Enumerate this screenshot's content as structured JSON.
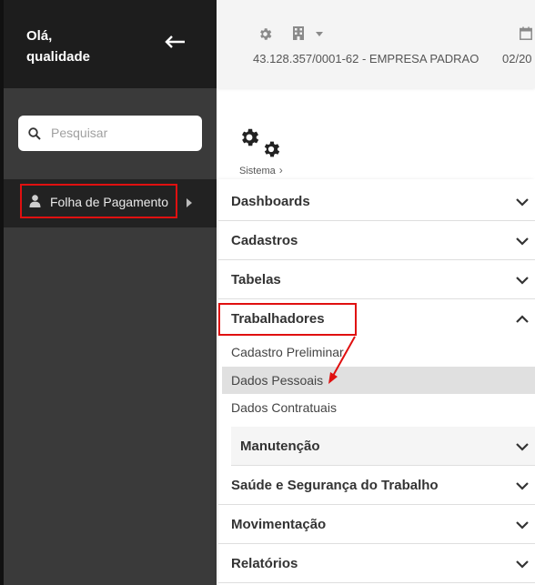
{
  "sidebar": {
    "greeting": "Olá,",
    "username": "qualidade",
    "search_placeholder": "Pesquisar",
    "nav_item": "Folha de Pagamento"
  },
  "topbar": {
    "company": "43.128.357/0001-62 - EMPRESA PADRAO",
    "date": "02/20"
  },
  "page": {
    "breadcrumb": "Sistema",
    "breadcrumb_separator": "›"
  },
  "menu": {
    "items": [
      {
        "label": "Dashboards",
        "expanded": false
      },
      {
        "label": "Cadastros",
        "expanded": false
      },
      {
        "label": "Tabelas",
        "expanded": false
      },
      {
        "label": "Trabalhadores",
        "expanded": true
      },
      {
        "label": "Saúde e Segurança do Trabalho",
        "expanded": false
      },
      {
        "label": "Movimentação",
        "expanded": false
      },
      {
        "label": "Relatórios",
        "expanded": false
      }
    ],
    "trabalhadores_children": [
      {
        "label": "Cadastro Preliminar",
        "active": false
      },
      {
        "label": "Dados Pessoais",
        "active": true
      },
      {
        "label": "Dados Contratuais",
        "active": false
      }
    ],
    "manutencao_label": "Manutenção"
  },
  "colors": {
    "highlight_red": "#e01010",
    "sidebar_dark": "#1d1d1d",
    "sidebar_bg": "#3a3a3a",
    "active_item_bg": "#e0e0e0"
  }
}
